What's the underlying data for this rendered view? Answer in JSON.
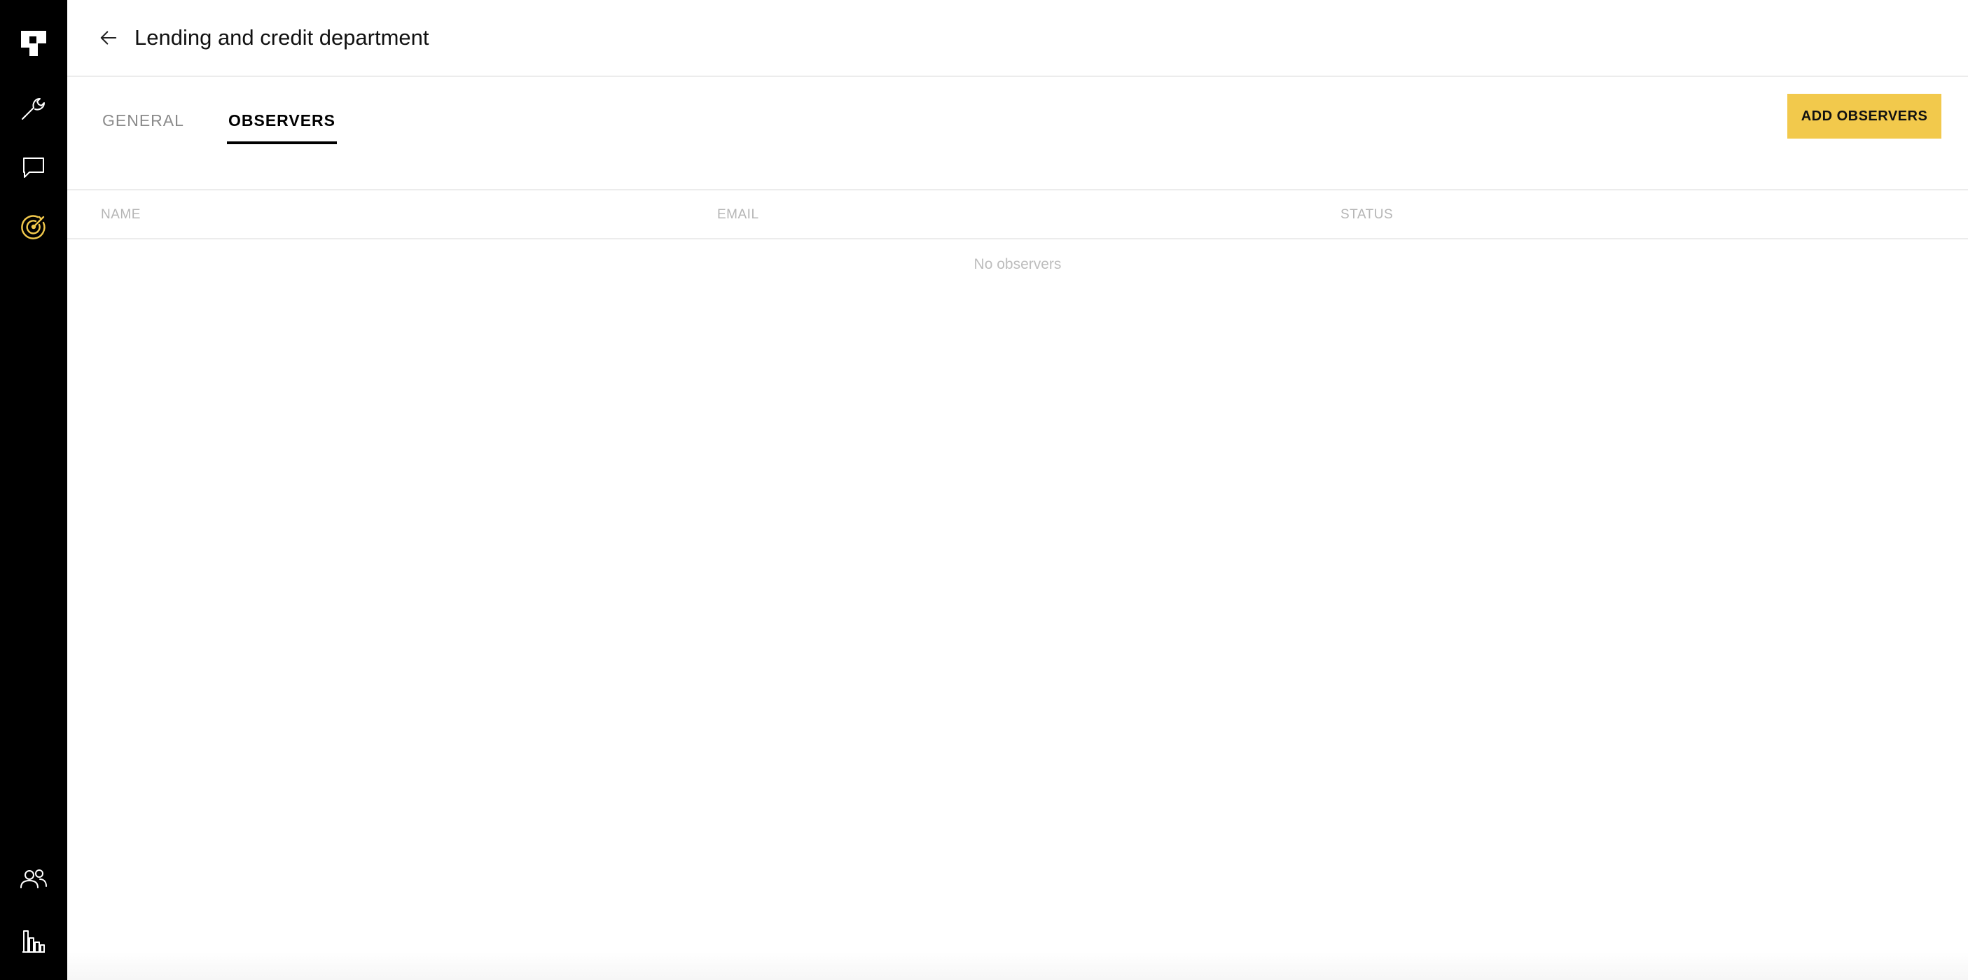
{
  "header": {
    "title": "Lending and credit department",
    "back_icon": "arrow-left-icon"
  },
  "sidebar": {
    "logo_icon": "brand-logo-icon",
    "items": [
      {
        "icon": "wrench-icon"
      },
      {
        "icon": "chat-icon"
      },
      {
        "icon": "target-icon",
        "active": true
      },
      {
        "icon": "users-icon"
      },
      {
        "icon": "bar-chart-icon"
      }
    ]
  },
  "tabs": [
    {
      "label": "GENERAL",
      "active": false
    },
    {
      "label": "OBSERVERS",
      "active": true
    }
  ],
  "actions": {
    "add_observers_label": "ADD OBSERVERS"
  },
  "table": {
    "columns": [
      "NAME",
      "EMAIL",
      "STATUS"
    ],
    "rows": [],
    "empty_message": "No observers"
  },
  "colors": {
    "sidebar_bg": "#000000",
    "accent": "#f2c94c",
    "active_icon": "#f2c94c"
  }
}
